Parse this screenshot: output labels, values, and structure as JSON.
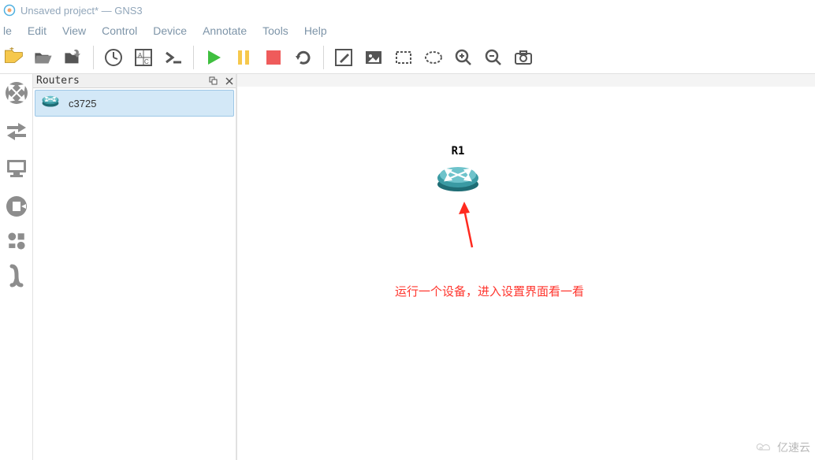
{
  "window": {
    "title": "Unsaved project* — GNS3"
  },
  "menu": {
    "items": [
      "le",
      "Edit",
      "View",
      "Control",
      "Device",
      "Annotate",
      "Tools",
      "Help"
    ]
  },
  "toolbar": {
    "new_project": "new-project",
    "open_project": "open-project",
    "save_project": "save-project",
    "clock": "snapshot",
    "manage": "manage",
    "console": "console",
    "play": "start",
    "pause": "pause",
    "stop": "stop",
    "reload": "reload",
    "note": "add-note",
    "image": "insert-image",
    "rect": "draw-rectangle",
    "ellipse": "draw-ellipse",
    "zoom_in": "zoom-in",
    "zoom_out": "zoom-out",
    "screenshot": "screenshot"
  },
  "dock": {
    "routers": "routers",
    "switches": "switches",
    "end_devices": "end-devices",
    "security": "security-devices",
    "all": "all-devices",
    "link": "add-link"
  },
  "panel": {
    "title": "Routers",
    "device_name": "c3725"
  },
  "canvas": {
    "node_label": "R1",
    "annotation": "运行一个设备，进入设置界面看一看"
  },
  "watermark": {
    "text": "亿速云"
  }
}
